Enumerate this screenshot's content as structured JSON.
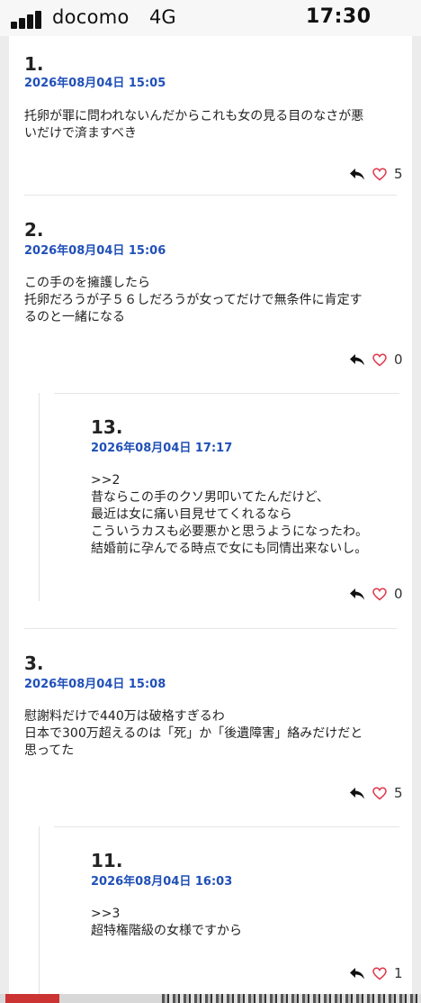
{
  "status_bar": {
    "carrier": "docomo",
    "network": "4G",
    "time": "17:30"
  },
  "comments": [
    {
      "number": "1.",
      "date": "2026年08月04日 15:05",
      "lines": [
        "托卵が罪に問われないんだからこれも女の見る目のなさが悪",
        "いだけで済ますべき"
      ],
      "likes": "5"
    },
    {
      "number": "2.",
      "date": "2026年08月04日 15:06",
      "lines": [
        "この手のを擁護したら",
        "托卵だろうが子５６しだろうが女ってだけで無条件に肯定す",
        "るのと一緒になる"
      ],
      "likes": "0"
    },
    {
      "number": "13.",
      "date": "2026年08月04日 17:17",
      "lines": [
        ">>2",
        "昔ならこの手のクソ男叩いてたんだけど、",
        "最近は女に痛い目見せてくれるなら",
        "こういうカスも必要悪かと思うようになったわ。",
        "結婚前に孕んでる時点で女にも同情出来ないし。"
      ],
      "likes": "0"
    },
    {
      "number": "3.",
      "date": "2026年08月04日 15:08",
      "lines": [
        "慰謝料だけで440万は破格すぎるわ",
        "日本で300万超えるのは「死」か「後遺障害」絡みだけだと",
        "思ってた"
      ],
      "likes": "5"
    },
    {
      "number": "11.",
      "date": "2026年08月04日 16:03",
      "lines": [
        ">>3",
        "超特権階級の女様ですから"
      ],
      "likes": "1"
    }
  ],
  "icons": {
    "reply": "reply-arrow-icon",
    "like": "heart-outline-icon"
  },
  "colors": {
    "date": "#2050b8",
    "heart": "#e0364a",
    "background": "#ececec"
  }
}
